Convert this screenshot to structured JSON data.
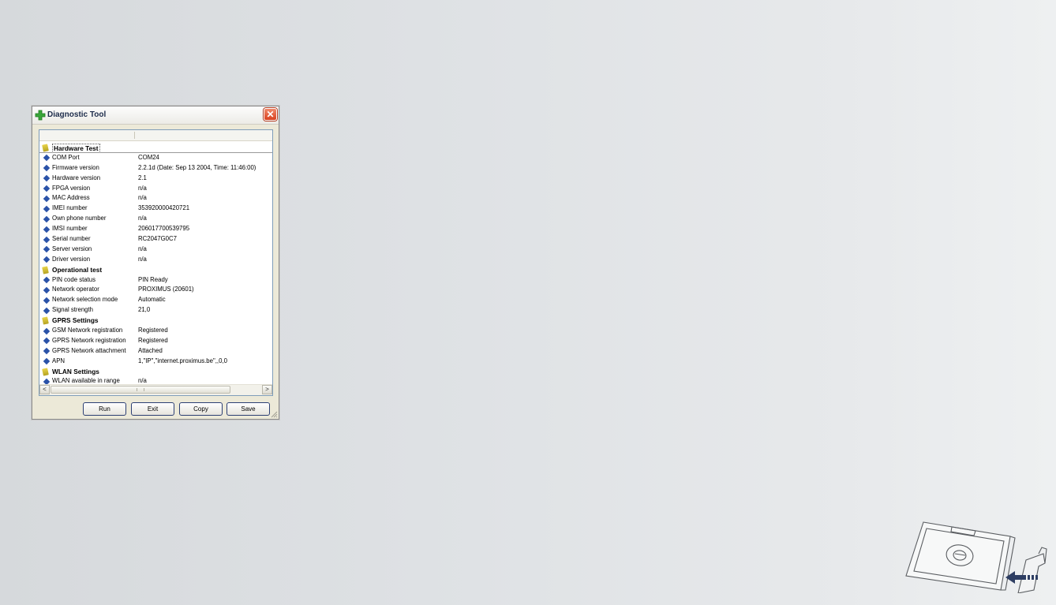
{
  "window": {
    "title": "Diagnostic Tool",
    "close_symbol": "✕"
  },
  "rows": [
    {
      "type": "section",
      "label": "Hardware Test",
      "value": ""
    },
    {
      "type": "item",
      "label": "COM Port",
      "value": "COM24"
    },
    {
      "type": "item",
      "label": "Firmware version",
      "value": "2.2.1d  (Date: Sep 13 2004, Time: 11:46:00)"
    },
    {
      "type": "item",
      "label": "Hardware version",
      "value": "2.1"
    },
    {
      "type": "item",
      "label": "FPGA version",
      "value": "n/a"
    },
    {
      "type": "item",
      "label": "MAC Address",
      "value": "n/a"
    },
    {
      "type": "item",
      "label": "IMEI number",
      "value": "353920000420721"
    },
    {
      "type": "item",
      "label": "Own phone number",
      "value": "n/a"
    },
    {
      "type": "item",
      "label": "IMSI number",
      "value": "206017700539795"
    },
    {
      "type": "item",
      "label": "Serial number",
      "value": "RC2047G0C7"
    },
    {
      "type": "item",
      "label": "Server version",
      "value": "n/a"
    },
    {
      "type": "item",
      "label": "Driver version",
      "value": "n/a"
    },
    {
      "type": "section",
      "label": "Operational test",
      "value": ""
    },
    {
      "type": "item",
      "label": "PIN code status",
      "value": "PIN Ready"
    },
    {
      "type": "item",
      "label": "Network operator",
      "value": "PROXIMUS (20601)"
    },
    {
      "type": "item",
      "label": "Network selection mode",
      "value": "Automatic"
    },
    {
      "type": "item",
      "label": "Signal strength",
      "value": "21,0"
    },
    {
      "type": "section",
      "label": "GPRS Settings",
      "value": ""
    },
    {
      "type": "item",
      "label": "GSM Network registration",
      "value": "Registered"
    },
    {
      "type": "item",
      "label": "GPRS Network registration",
      "value": "Registered"
    },
    {
      "type": "item",
      "label": "GPRS Network attachment",
      "value": "Attached"
    },
    {
      "type": "item",
      "label": "APN",
      "value": "1,\"IP\",\"internet.proximus.be\",,0,0"
    },
    {
      "type": "section",
      "label": "WLAN Settings",
      "value": ""
    },
    {
      "type": "item",
      "label": "WLAN available in range",
      "value": "n/a"
    }
  ],
  "scrollbar": {
    "left_arrow": "<",
    "right_arrow": ">"
  },
  "buttons": {
    "run": "Run",
    "exit": "Exit",
    "copy": "Copy",
    "save": "Save"
  },
  "colors": {
    "bullet_blue": "#2a52a8",
    "section_yellow": "#d4c23a",
    "close_red": "#d9401e",
    "title_icon_green": "#3aa63a"
  },
  "icons": {
    "title": "diagnostic-cross-icon",
    "item": "blue-diamond-icon",
    "section": "yellow-pencil-icon",
    "close": "close-icon"
  }
}
